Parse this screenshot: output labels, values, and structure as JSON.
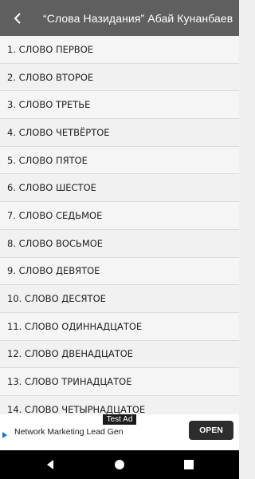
{
  "appbar": {
    "title": "“Слова Назидания” Абай Кунанбаев",
    "back_icon": "arrow-left-icon"
  },
  "list": {
    "items": [
      "1. СЛОВО ПЕРВОЕ",
      "2. СЛОВО ВТОРОЕ",
      "3. СЛОВО ТРЕТЬЕ",
      "4. СЛОВО ЧЕТВЁРТОЕ",
      "5. СЛОВО ПЯТОЕ",
      "6. СЛОВО ШЕСТОЕ",
      "7. СЛОВО СЕДЬМОЕ",
      "8. СЛОВО ВОСЬМОЕ",
      "9. СЛОВО ДЕВЯТОЕ",
      "10. СЛОВО ДЕСЯТОЕ",
      "11. СЛОВО ОДИННАДЦАТОЕ",
      "12. СЛОВО ДВЕНАДЦАТОЕ",
      "13. СЛОВО ТРИНАДЦАТОЕ",
      "14. СЛОВО ЧЕТЫРНАДЦАТОЕ"
    ]
  },
  "ad": {
    "tag": "Test Ad",
    "text": "Network Marketing Lead Gen",
    "button": "OPEN",
    "icon": "play-triangle-icon"
  },
  "navbar": {
    "icons": [
      "back-triangle-icon",
      "home-circle-icon",
      "recents-square-icon"
    ]
  },
  "colors": {
    "appbar": "#5f5f5f",
    "list_bg": "#f4f4f4",
    "ad_button": "#2d2d2d",
    "navbar": "#000000"
  }
}
